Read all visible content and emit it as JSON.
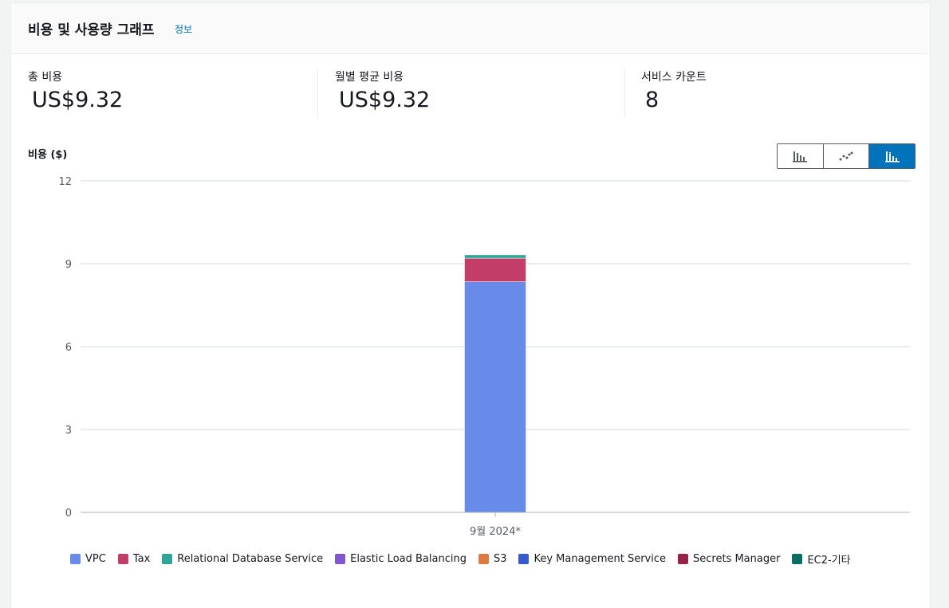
{
  "panel": {
    "title": "비용 및 사용량 그래프",
    "info_link": "정보"
  },
  "metrics": [
    {
      "label": "총 비용",
      "value": "US$9.32"
    },
    {
      "label": "월별 평균 비용",
      "value": "US$9.32"
    },
    {
      "label": "서비스 카운트",
      "value": "8"
    }
  ],
  "toggle": {
    "buttons": [
      {
        "icon": "bar-chart-icon",
        "active": false
      },
      {
        "icon": "line-chart-icon",
        "active": false
      },
      {
        "icon": "stacked-bar-chart-icon",
        "active": true
      }
    ]
  },
  "colors": {
    "accent": "#0073bb",
    "grid": "#d5dbdb"
  },
  "chart_data": {
    "type": "bar",
    "stacked": true,
    "ylabel": "비용 ($)",
    "xlabel": "",
    "ylim": [
      0,
      12
    ],
    "yticks": [
      0,
      3,
      6,
      9,
      12
    ],
    "grid": true,
    "legend_position": "bottom",
    "categories": [
      "9월 2024*"
    ],
    "series": [
      {
        "name": "VPC",
        "values": [
          8.35
        ],
        "color": "#688ae8"
      },
      {
        "name": "Tax",
        "values": [
          0.85
        ],
        "color": "#c33d69"
      },
      {
        "name": "Relational Database Service",
        "values": [
          0.12
        ],
        "color": "#2ea597"
      },
      {
        "name": "Elastic Load Balancing",
        "values": [
          0.0
        ],
        "color": "#8456ce"
      },
      {
        "name": "S3",
        "values": [
          0.0
        ],
        "color": "#e07941"
      },
      {
        "name": "Key Management Service",
        "values": [
          0.0
        ],
        "color": "#3759ce"
      },
      {
        "name": "Secrets Manager",
        "values": [
          0.0
        ],
        "color": "#962249"
      },
      {
        "name": "EC2-기타",
        "values": [
          0.0
        ],
        "color": "#096f64"
      }
    ]
  }
}
